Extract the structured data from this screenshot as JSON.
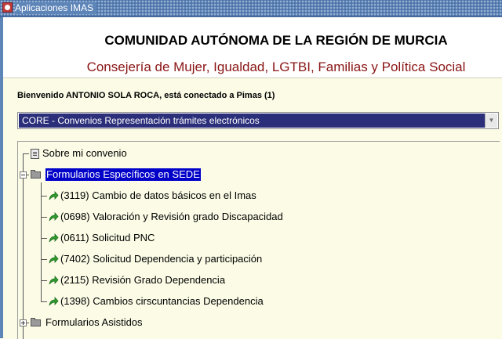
{
  "window": {
    "title": "Aplicaciones IMAS"
  },
  "header": {
    "org_title": "COMUNIDAD AUTÓNOMA DE LA REGIÓN DE MURCIA",
    "dept_title": "Consejería de Mujer, Igualdad, LGTBI, Familias y Política Social"
  },
  "welcome": "Bienvenido ANTONIO SOLA ROCA, está conectado a Pimas (1)",
  "selector": {
    "value": "CORE - Convenios Representación trámites electrónicos"
  },
  "tree": {
    "sobre": "Sobre mi convenio",
    "group1": {
      "label": "Formularios Específicos en SEDE",
      "items": [
        "(3119) Cambio de datos básicos en el Imas",
        "(0698) Valoración y Revisión grado Discapacidad",
        "(0611) Solicitud PNC",
        "(7402) Solicitud Dependencia y participación",
        "(2115) Revisión Grado Dependencia",
        "(1398) Cambios cirscuntancias Dependencia"
      ]
    },
    "group2": {
      "label": "Formularios Asistidos"
    }
  },
  "colors": {
    "titlebar": "#5e85b8",
    "background": "#fbfbe6",
    "dept_title": "#8a1414",
    "selector_bg": "#2b2f7a",
    "selected_node": "#0000c8",
    "leaf_arrow": "#2e9e2e"
  },
  "icons": {
    "window": "app-icon",
    "leaf": "green-arrow-icon",
    "folder": "folder-icon",
    "document": "document-icon"
  }
}
